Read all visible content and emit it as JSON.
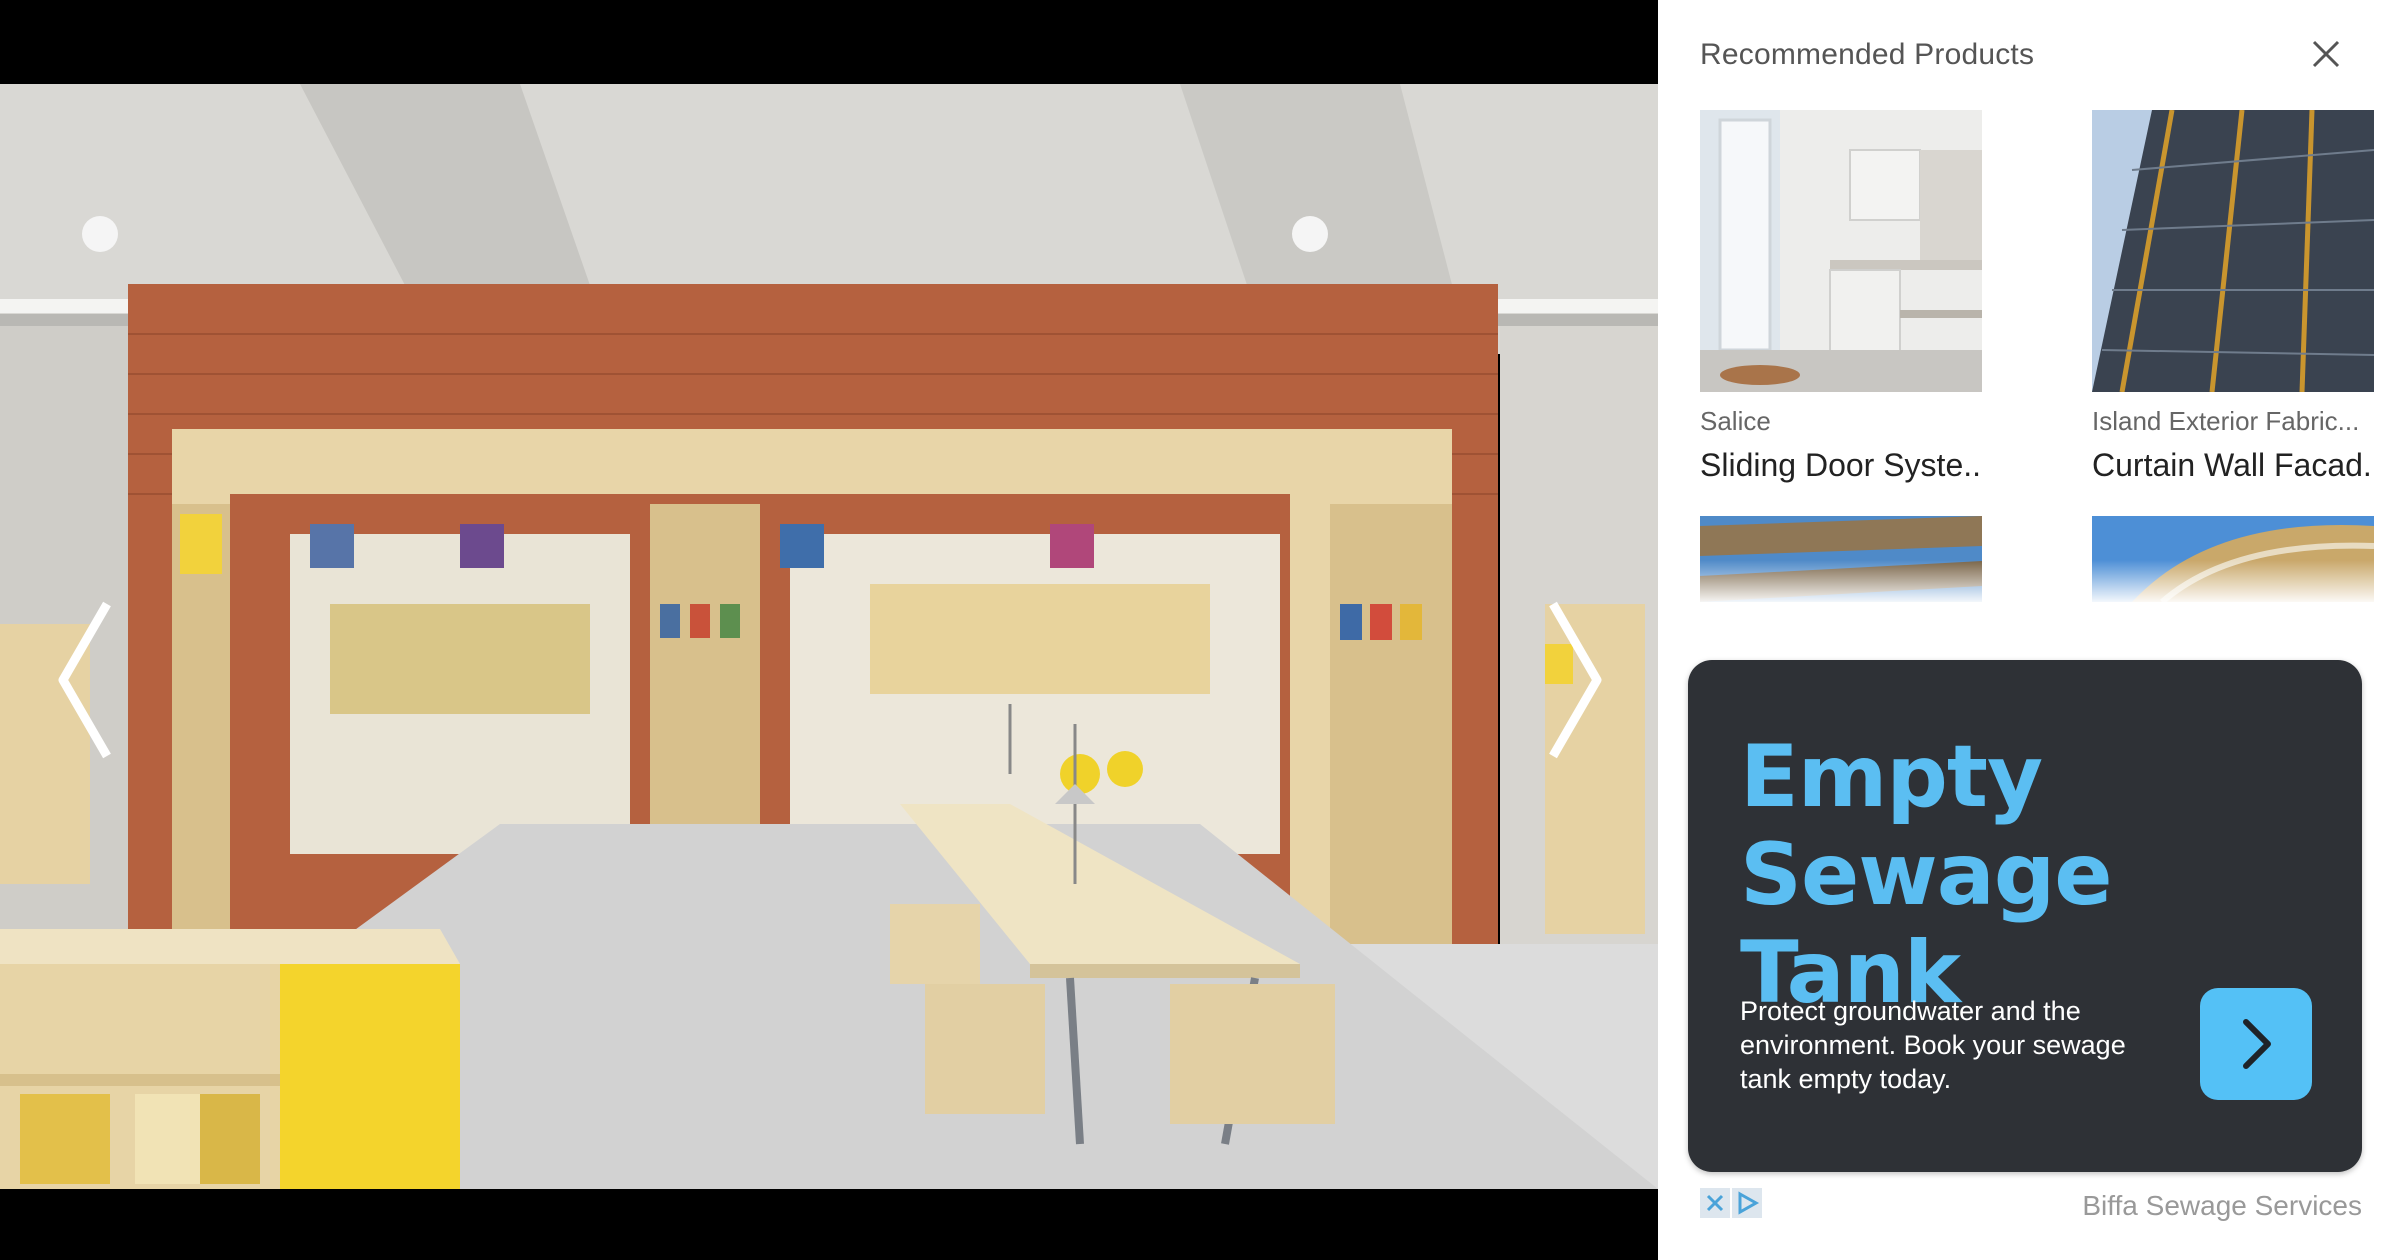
{
  "viewer": {
    "prev_icon": "chevron-left-icon",
    "next_icon": "chevron-right-icon"
  },
  "panel": {
    "title": "Recommended Products",
    "close_icon": "close-icon",
    "products": [
      {
        "brand": "Salice",
        "name": "Sliding Door Syste..."
      },
      {
        "brand": "Island Exterior Fabric...",
        "name": "Curtain Wall Facad..."
      }
    ]
  },
  "ad": {
    "headline_line1": "Empty",
    "headline_line2": "Sewage Tank",
    "body": "Protect groundwater and the environment. Book your sewage tank empty today.",
    "cta_icon": "chevron-right-icon",
    "sponsor": "Biffa Sewage Services",
    "adchoices_icon": "adchoices-icon",
    "colors": {
      "card": "#2e3136",
      "headline": "#5bbef2",
      "cta": "#54c1f6"
    }
  }
}
